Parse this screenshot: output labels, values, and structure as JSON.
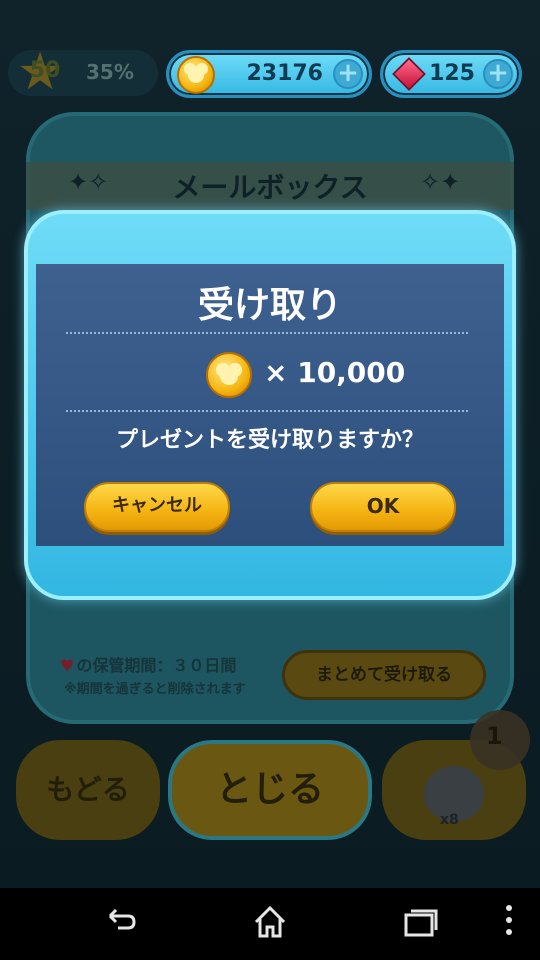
{
  "status": {
    "level": "50",
    "level_progress": "35%",
    "coins": "23176",
    "gems": "125",
    "plus_symbol": "+"
  },
  "mailbox": {
    "title": "メールボックス",
    "retention_note": "の保管期間：３０日間",
    "deletion_note": "※期間を過ぎると削除されます",
    "bulk_receive_label": "まとめて受け取る"
  },
  "bottom": {
    "back_label": "もどる",
    "close_label": "とじる",
    "tsum_count": "x8",
    "tsum_tag": "1"
  },
  "dialog": {
    "title": "受け取り",
    "reward_amount": "× 10,000",
    "question": "プレゼントを受け取りますか？",
    "cancel_label": "キャンセル",
    "ok_label": "OK"
  },
  "colors": {
    "dialog_frame": "#4fc9ef",
    "dialog_body": "#34578a",
    "button_gold": "#f5b311"
  },
  "icons": [
    "star-icon",
    "coin-icon",
    "gem-icon",
    "plus-icon",
    "heart-icon",
    "sparkle-icon",
    "back-nav-icon",
    "home-nav-icon",
    "recents-nav-icon",
    "menu-nav-icon"
  ]
}
